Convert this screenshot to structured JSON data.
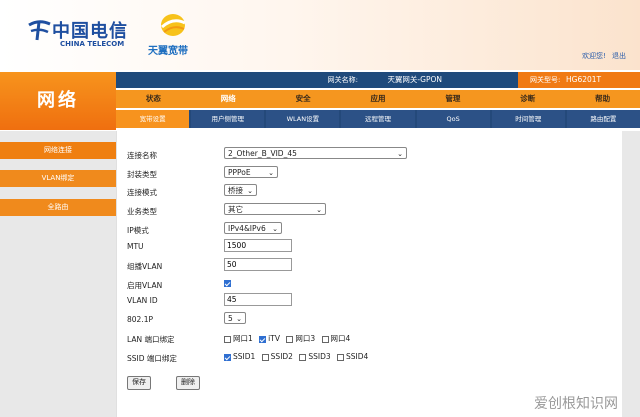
{
  "header": {
    "brand_cn": "中国电信",
    "brand_en": "CHINA TELECOM",
    "tianyi": "天翼宽带",
    "links": [
      "欢迎您!",
      "退出"
    ]
  },
  "page_title": "网络",
  "info": {
    "gateway_name_label": "网关名称:",
    "gateway_name": "天翼网关-GPON",
    "model_label": "网关型号:",
    "model": "HG6201T"
  },
  "main_nav": [
    "状态",
    "网络",
    "安全",
    "应用",
    "管理",
    "诊断",
    "帮助"
  ],
  "sub_nav": [
    "宽带设置",
    "用户侧管理",
    "WLAN设置",
    "远程管理",
    "QoS",
    "时间管理",
    "路由配置"
  ],
  "sidebar": [
    "网络连接",
    "VLAN绑定",
    "全路由"
  ],
  "form": {
    "connection_name": {
      "label": "连接名称",
      "value": "2_Other_B_VID_45"
    },
    "encapsulation": {
      "label": "封装类型",
      "value": "PPPoE"
    },
    "connection_mode": {
      "label": "连接模式",
      "value": "桥接"
    },
    "service_type": {
      "label": "业务类型",
      "value": "其它"
    },
    "ip_mode": {
      "label": "IP模式",
      "value": "IPv4&IPv6"
    },
    "mtu": {
      "label": "MTU",
      "value": "1500"
    },
    "multicast_vlan": {
      "label": "组播VLAN",
      "value": "50"
    },
    "enable_vlan": {
      "label": "启用VLAN"
    },
    "vlan_id": {
      "label": "VLAN ID",
      "value": "45"
    },
    "priority": {
      "label": "802.1P",
      "value": "5"
    },
    "lan_bind": {
      "label": "LAN 端口绑定",
      "options": [
        "网口1",
        "iTV",
        "网口3",
        "网口4"
      ]
    },
    "ssid_bind": {
      "label": "SSID 端口绑定",
      "options": [
        "SSID1",
        "SSID2",
        "SSID3",
        "SSID4"
      ]
    },
    "save": "保存",
    "delete": "删除"
  },
  "watermark": "爱创根知识网",
  "colors": {
    "orange": "#f5961f",
    "navy": "#1e4a7c",
    "brand_blue": "#1f4fa0"
  }
}
